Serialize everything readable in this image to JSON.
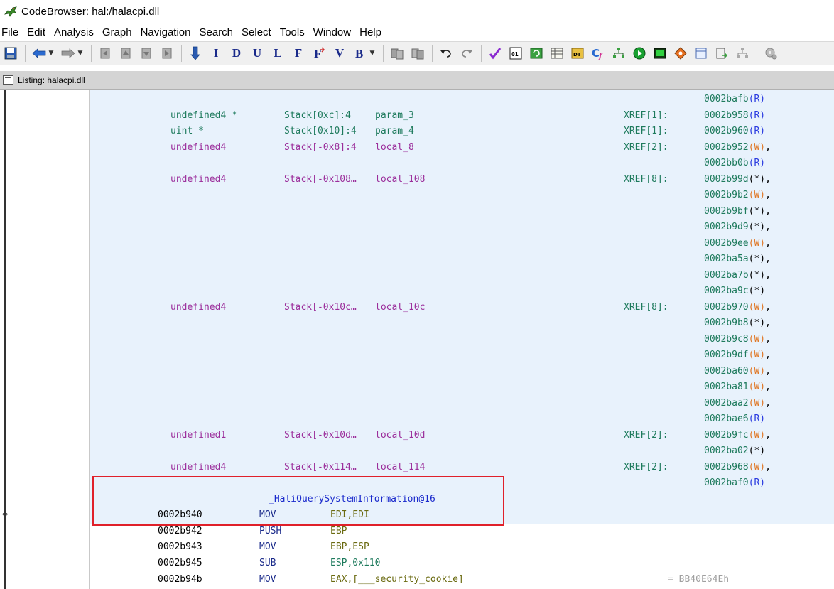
{
  "window": {
    "title": "CodeBrowser: hal:/halacpi.dll"
  },
  "menu": [
    "File",
    "Edit",
    "Analysis",
    "Graph",
    "Navigation",
    "Search",
    "Select",
    "Tools",
    "Window",
    "Help"
  ],
  "toolbar": {
    "letters": [
      "I",
      "D",
      "U",
      "L",
      "F",
      "V"
    ]
  },
  "panel": {
    "title": "Listing:  halacpi.dll"
  },
  "vars": [
    {
      "type": "undefined4 *",
      "stack": "Stack[0xc]:4",
      "name": "param_3",
      "xref": "XREF[1]:",
      "refs": [
        [
          "0002b958",
          "(R)"
        ]
      ]
    },
    {
      "type": "uint *",
      "stack": "Stack[0x10]:4",
      "name": "param_4",
      "xref": "XREF[1]:",
      "refs": [
        [
          "0002b960",
          "(R)"
        ]
      ]
    },
    {
      "type": "undefined4",
      "stack": "Stack[-0x8]:4",
      "name": "local_8",
      "xref": "XREF[2]:",
      "refs": [
        [
          "0002b952",
          "(W)"
        ],
        [
          "0002bb0b",
          "(R)"
        ]
      ]
    },
    {
      "type": "undefined4",
      "stack": "Stack[-0x108…",
      "name": "local_108",
      "xref": "XREF[8]:",
      "refs": [
        [
          "0002b99d",
          "(*)"
        ],
        [
          "0002b9b2",
          "(W)"
        ],
        [
          "0002b9bf",
          "(*)"
        ],
        [
          "0002b9d9",
          "(*)"
        ],
        [
          "0002b9ee",
          "(W)"
        ],
        [
          "0002ba5a",
          "(*)"
        ],
        [
          "0002ba7b",
          "(*)"
        ],
        [
          "0002ba9c",
          "(*)"
        ]
      ]
    },
    {
      "type": "undefined4",
      "stack": "Stack[-0x10c…",
      "name": "local_10c",
      "xref": "XREF[8]:",
      "refs": [
        [
          "0002b970",
          "(W)"
        ],
        [
          "0002b9b8",
          "(*)"
        ],
        [
          "0002b9c8",
          "(W)"
        ],
        [
          "0002b9df",
          "(W)"
        ],
        [
          "0002ba60",
          "(W)"
        ],
        [
          "0002ba81",
          "(W)"
        ],
        [
          "0002baa2",
          "(W)"
        ],
        [
          "0002bae6",
          "(R)"
        ]
      ]
    },
    {
      "type": "undefined1",
      "stack": "Stack[-0x10d…",
      "name": "local_10d",
      "xref": "XREF[2]:",
      "refs": [
        [
          "0002b9fc",
          "(W)"
        ],
        [
          "0002ba02",
          "(*)"
        ]
      ]
    },
    {
      "type": "undefined4",
      "stack": "Stack[-0x114…",
      "name": "local_114",
      "xref": "XREF[2]:",
      "refs": [
        [
          "0002b968",
          "(W)"
        ],
        [
          "0002baf0",
          "(R)"
        ]
      ]
    }
  ],
  "top_ref": [
    "0002bafb",
    "(R)"
  ],
  "function_label": "_HaliQuerySystemInformation@16",
  "instructions": [
    {
      "addr": "0002b940",
      "mnem": "MOV",
      "ops": "EDI,EDI"
    },
    {
      "addr": "0002b942",
      "mnem": "PUSH",
      "ops": "EBP"
    },
    {
      "addr": "0002b943",
      "mnem": "MOV",
      "ops": "EBP,ESP"
    },
    {
      "addr": "0002b945",
      "mnem": "SUB",
      "ops": "ESP,0x110"
    },
    {
      "addr": "0002b94b",
      "mnem": "MOV",
      "ops": "EAX,[___security_cookie]",
      "comment": "= BB40E64Eh"
    }
  ]
}
